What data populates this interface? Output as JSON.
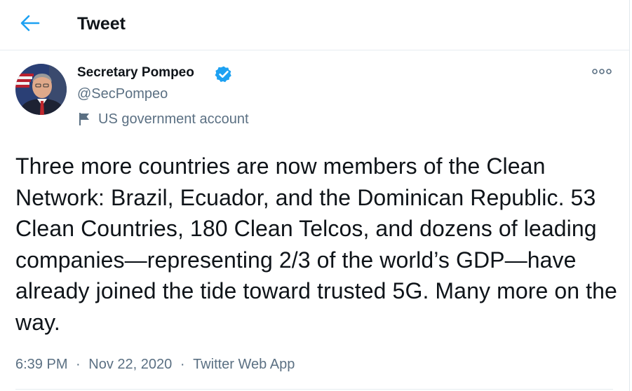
{
  "header": {
    "title": "Tweet",
    "back_icon": "arrow-left-icon"
  },
  "author": {
    "name": "Secretary Pompeo",
    "handle": "@SecPompeo",
    "verified_icon": "verified-badge-icon",
    "account_label": "US government account",
    "account_label_icon": "flag-icon"
  },
  "tweet": {
    "text": "Three more countries are now members of the Clean Network: Brazil, Ecuador, and the Dominican Republic. 53 Clean Countries, 180 Clean Telcos, and dozens of leading companies—representing 2/3 of the world’s GDP—have already joined the tide toward trusted 5G. Many more on the way.",
    "time": "6:39 PM",
    "date": "Nov 22, 2020",
    "source": "Twitter Web App",
    "separator": "·"
  },
  "more_icon": "more-dots-icon",
  "colors": {
    "accent": "#1da1f2",
    "text_primary": "#0f1419",
    "text_secondary": "#5b7083",
    "border": "#e6ecf0"
  }
}
